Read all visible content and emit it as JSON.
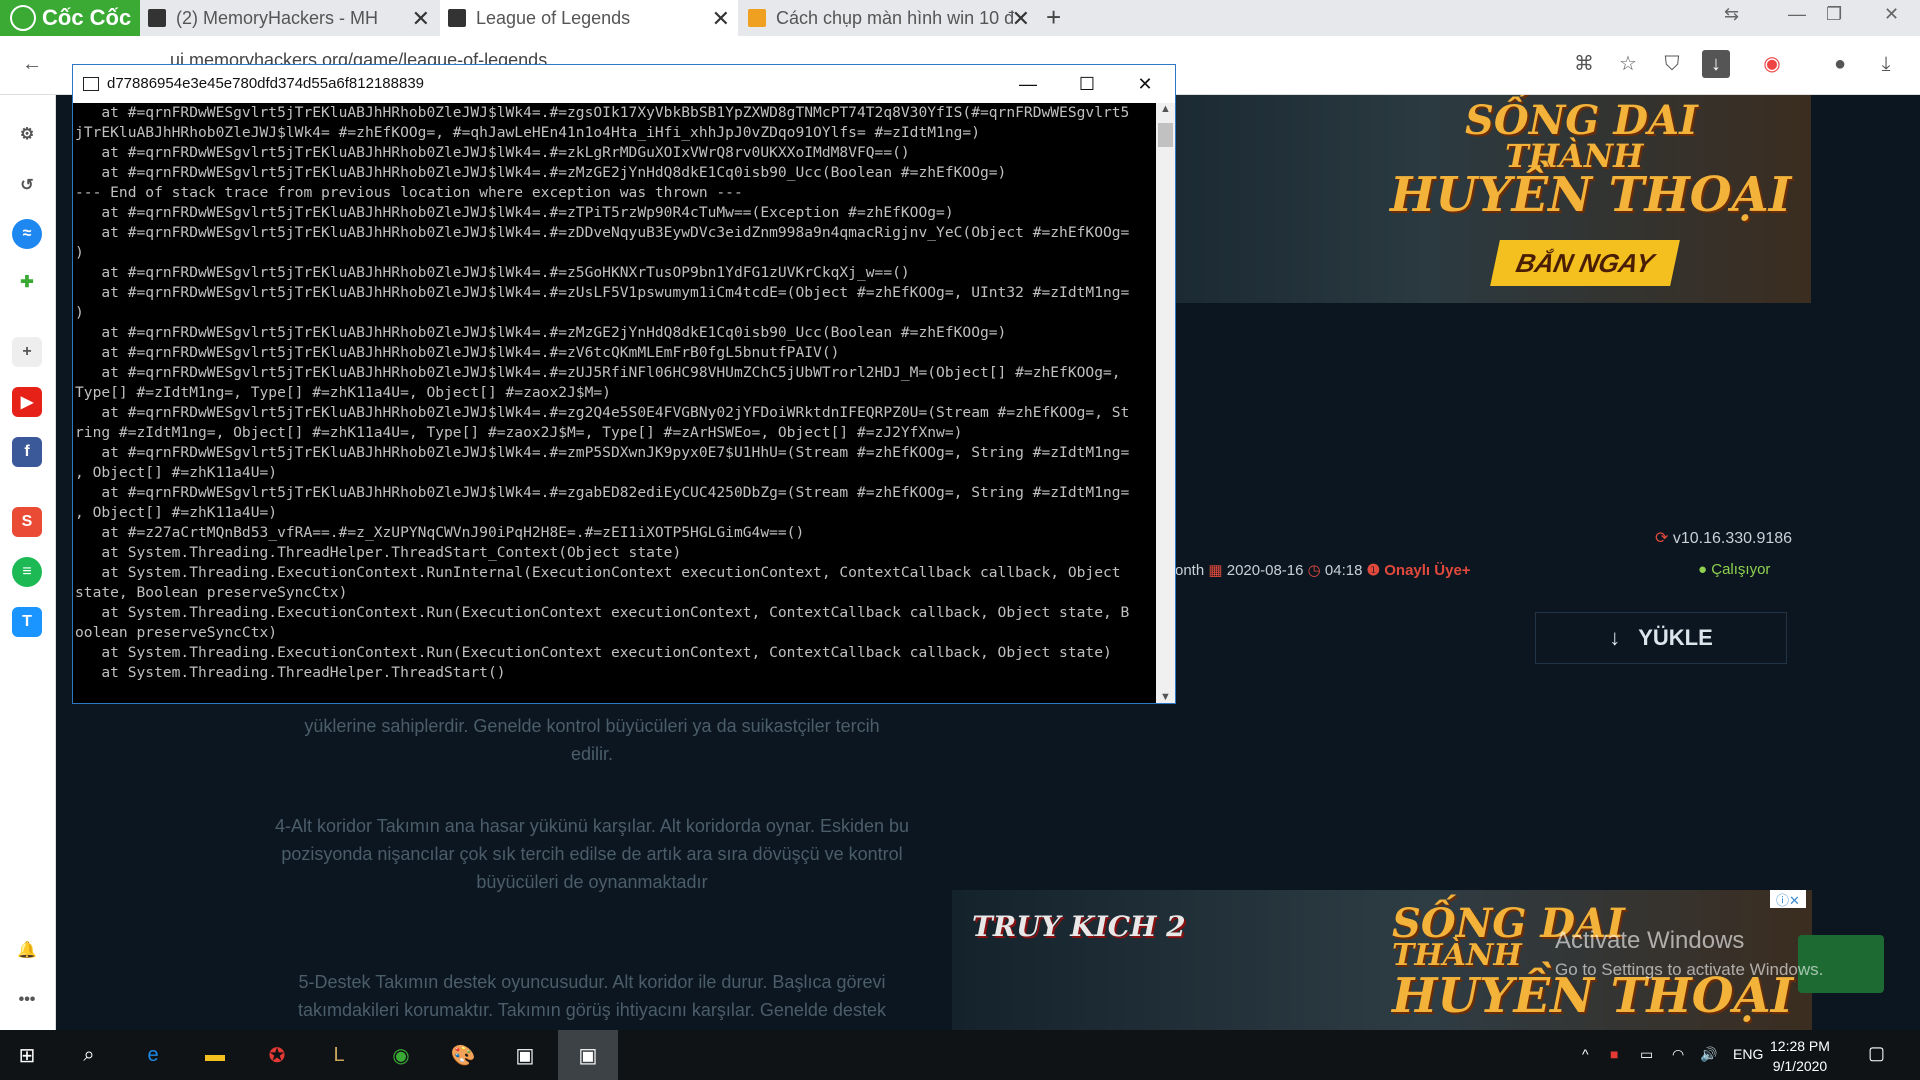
{
  "browser": {
    "brand": "Cốc Cốc",
    "tabs": [
      {
        "title": "(2) MemoryHackers - MH"
      },
      {
        "title": "League of Legends"
      },
      {
        "title": "Cách chụp màn hình win 10 đ"
      }
    ],
    "url": "uj.memoryhackers.org/game/league-of-legends"
  },
  "console": {
    "title": "d77886954e3e45e780dfd374d55a6f812188839",
    "lines": [
      "   at #=qrnFRDwWESgvlrt5jTrEKluABJhHRhob0ZleJWJ$lWk4=.#=zgsOIk17XyVbkBbSB1YpZXWD8gTNMcPT74T2q8V30YfIS(#=qrnFRDwWESgvlrt5",
      "jTrEKluABJhHRhob0ZleJWJ$lWk4= #=zhEfKOOg=, #=qhJawLeHEn41n1o4Hta_iHfi_xhhJpJ0vZDqo91OYlfs= #=zIdtM1ng=)",
      "   at #=qrnFRDwWESgvlrt5jTrEKluABJhHRhob0ZleJWJ$lWk4=.#=zkLgRrMDGuXOIxVWrQ8rv0UKXXoIMdM8VFQ==()",
      "   at #=qrnFRDwWESgvlrt5jTrEKluABJhHRhob0ZleJWJ$lWk4=.#=zMzGE2jYnHdQ8dkE1Cq0isb90_Ucc(Boolean #=zhEfKOOg=)",
      "--- End of stack trace from previous location where exception was thrown ---",
      "   at #=qrnFRDwWESgvlrt5jTrEKluABJhHRhob0ZleJWJ$lWk4=.#=zTPiT5rzWp90R4cTuMw==(Exception #=zhEfKOOg=)",
      "   at #=qrnFRDwWESgvlrt5jTrEKluABJhHRhob0ZleJWJ$lWk4=.#=zDDveNqyuB3EywDVc3eidZnm998a9n4qmacRigjnv_YeC(Object #=zhEfKOOg=",
      ")",
      "   at #=qrnFRDwWESgvlrt5jTrEKluABJhHRhob0ZleJWJ$lWk4=.#=z5GoHKNXrTusOP9bn1YdFG1zUVKrCkqXj_w==()",
      "   at #=qrnFRDwWESgvlrt5jTrEKluABJhHRhob0ZleJWJ$lWk4=.#=zUsLF5V1pswumym1iCm4tcdE=(Object #=zhEfKOOg=, UInt32 #=zIdtM1ng=",
      ")",
      "   at #=qrnFRDwWESgvlrt5jTrEKluABJhHRhob0ZleJWJ$lWk4=.#=zMzGE2jYnHdQ8dkE1Cq0isb90_Ucc(Boolean #=zhEfKOOg=)",
      "   at #=qrnFRDwWESgvlrt5jTrEKluABJhHRhob0ZleJWJ$lWk4=.#=zV6tcQKmMLEmFrB0fgL5bnutfPAIV()",
      "   at #=qrnFRDwWESgvlrt5jTrEKluABJhHRhob0ZleJWJ$lWk4=.#=zUJ5RfiNFl06HC98VHUmZChC5jUbWTrorl2HDJ_M=(Object[] #=zhEfKOOg=,",
      "Type[] #=zIdtM1ng=, Type[] #=zhK11a4U=, Object[] #=zaox2J$M=)",
      "   at #=qrnFRDwWESgvlrt5jTrEKluABJhHRhob0ZleJWJ$lWk4=.#=zg2Q4e5S0E4FVGBNy02jYFDoiWRktdnIFEQRPZ0U=(Stream #=zhEfKOOg=, St",
      "ring #=zIdtM1ng=, Object[] #=zhK11a4U=, Type[] #=zaox2J$M=, Type[] #=zArHSWEo=, Object[] #=zJ2YfXnw=)",
      "   at #=qrnFRDwWESgvlrt5jTrEKluABJhHRhob0ZleJWJ$lWk4=.#=zmP5SDXwnJK9pyx0E7$U1HhU=(Stream #=zhEfKOOg=, String #=zIdtM1ng=",
      ", Object[] #=zhK11a4U=)",
      "   at #=qrnFRDwWESgvlrt5jTrEKluABJhHRhob0ZleJWJ$lWk4=.#=zgabED82ediEyCUC4250DbZg=(Stream #=zhEfKOOg=, String #=zIdtM1ng=",
      ", Object[] #=zhK11a4U=)",
      "   at #=z27aCrtMQnBd53_vfRA==.#=z_XzUPYNqCWVnJ90iPqH2H8E=.#=zEI1iXOTP5HGLGimG4w==()",
      "   at System.Threading.ThreadHelper.ThreadStart_Context(Object state)",
      "   at System.Threading.ExecutionContext.RunInternal(ExecutionContext executionContext, ContextCallback callback, Object",
      "state, Boolean preserveSyncCtx)",
      "   at System.Threading.ExecutionContext.Run(ExecutionContext executionContext, ContextCallback callback, Object state, B",
      "oolean preserveSyncCtx)",
      "   at System.Threading.ExecutionContext.Run(ExecutionContext executionContext, ContextCallback callback, Object state)",
      "   at System.Threading.ThreadHelper.ThreadStart()"
    ]
  },
  "page": {
    "ad_title_line1": "SỐNG DAI",
    "ad_title_line2": "THÀNH",
    "ad_title_line3": "HUYỀN THOẠI",
    "ad_button": "BẮN NGAY",
    "ad_logo": "TRUY KICH 2",
    "version": "v10.16.330.9186",
    "meta_prefix": "onth",
    "date": "2020-08-16",
    "time": "04:18",
    "approved": "Onaylı Üye+",
    "status": "Çalışıyor",
    "download": "YÜKLE",
    "para1_line1": "yüklerine sahiplerdir. Genelde kontrol büyücüleri ya da suikastçiler tercih",
    "para1_line2": "edilir.",
    "para2": "4-Alt koridor Takımın ana hasar yükünü karşılar. Alt koridorda oynar. Eskiden bu pozisyonda nişancılar çok sık tercih edilse de artık ara sıra dövüşçü ve kontrol büyücüleri de oynanmaktadır",
    "para3": "5-Destek Takımın destek oyuncusudur. Alt koridor ile durur. Başlıca görevi takımdakileri korumaktır. Takımın görüş ihtiyacını karşılar. Genelde destek",
    "watermark_title": "Activate Windows",
    "watermark_sub": "Go to Settings to activate Windows."
  },
  "taskbar": {
    "language": "ENG",
    "time": "12:28 PM",
    "date": "9/1/2020"
  },
  "colors": {
    "brand_green": "#3aaa35",
    "console_bg": "#000000",
    "console_text": "#c0c0c0",
    "page_bg": "#0b1620",
    "ad_gold": "#f3b23a",
    "status_green": "#8fd14f"
  }
}
